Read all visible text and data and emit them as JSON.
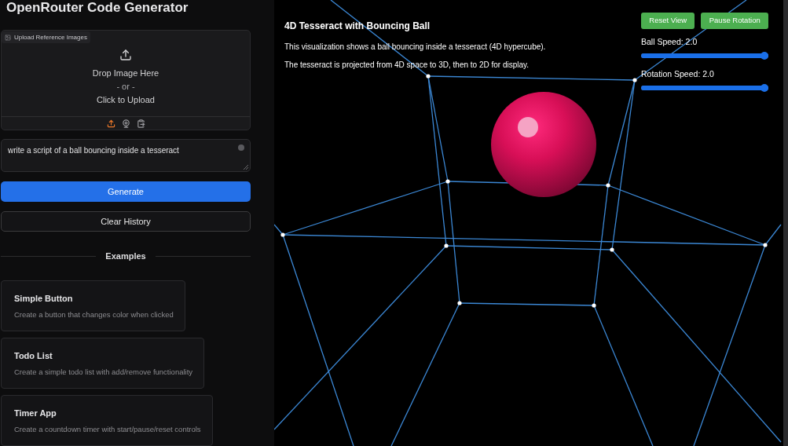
{
  "sidebar": {
    "title": "OpenRouter Code Generator",
    "upload": {
      "label": "Upload Reference Images",
      "drop_text": "Drop Image Here",
      "or_text": "- or -",
      "click_text": "Click to Upload",
      "sources": [
        {
          "kind": "upload",
          "selected": true
        },
        {
          "kind": "webcam",
          "selected": false
        },
        {
          "kind": "clipboard",
          "selected": false
        }
      ]
    },
    "prompt": {
      "value": "write a script of a ball bouncing inside a tesseract"
    },
    "buttons": [
      {
        "label": "Generate",
        "kind": "primary"
      },
      {
        "label": "Clear History",
        "kind": "secondary"
      }
    ],
    "examples_heading": "Examples",
    "examples": [
      {
        "title": "Simple Button",
        "description": "Create a button that changes color when clicked"
      },
      {
        "title": "Todo List",
        "description": "Create a simple todo list with add/remove functionality"
      },
      {
        "title": "Timer App",
        "description": "Create a countdown timer with start/pause/reset controls"
      }
    ]
  },
  "preview": {
    "title": "4D Tesseract with Bouncing Ball",
    "paragraphs": [
      "This visualization shows a ball bouncing inside a tesseract (4D hypercube).",
      "The tesseract is projected from 4D space to 3D, then to 2D for display."
    ],
    "buttons": [
      "Reset View",
      "Pause Rotation"
    ],
    "sliders": [
      {
        "label": "Ball Speed: 2.0",
        "level": 1
      },
      {
        "label": "Rotation Speed: 2.0",
        "level": 1
      }
    ]
  }
}
